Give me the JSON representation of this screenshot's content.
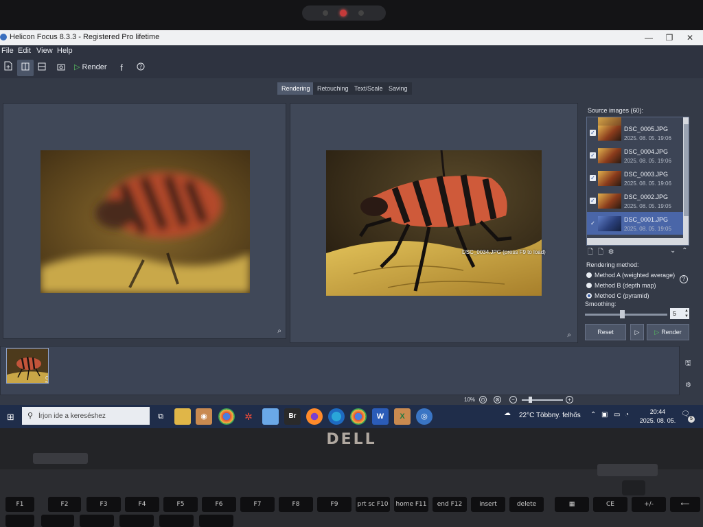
{
  "window": {
    "title": "Helicon Focus 8.3.3 - Registered Pro lifetime",
    "controls": [
      "—",
      "❐",
      "✕"
    ]
  },
  "menu": [
    "File",
    "Edit",
    "View",
    "Help"
  ],
  "toolbar": {
    "render_label": "Render"
  },
  "tabs": [
    "Rendering",
    "Retouching",
    "Text/Scale",
    "Saving"
  ],
  "preview": {
    "hint": "DSC_0034.JPG (press F9 to load)"
  },
  "sidebar": {
    "source_label": "Source images (60):",
    "images": [
      {
        "name": "DSC_0005.JPG",
        "date": "2025. 08. 05. 19:06",
        "checked": true,
        "selected": false
      },
      {
        "name": "DSC_0004.JPG",
        "date": "2025. 08. 05. 19:06",
        "checked": true,
        "selected": false
      },
      {
        "name": "DSC_0003.JPG",
        "date": "2025. 08. 05. 19:06",
        "checked": true,
        "selected": false
      },
      {
        "name": "DSC_0002.JPG",
        "date": "2025. 08. 05. 19:05",
        "checked": true,
        "selected": false
      },
      {
        "name": "DSC_0001.JPG",
        "date": "2025. 08. 05. 19:05",
        "checked": true,
        "selected": true
      }
    ],
    "rendering_method_label": "Rendering method:",
    "methods": [
      {
        "label": "Method A (weighted average)",
        "selected": false
      },
      {
        "label": "Method B (depth map)",
        "selected": false
      },
      {
        "label": "Method C (pyramid)",
        "selected": true
      }
    ],
    "smoothing_label": "Smoothing:",
    "smoothing_value": "5",
    "smoothing_fraction": 0.45,
    "reset_label": "Reset",
    "render_label": "Render"
  },
  "strip": {
    "tag": "C 5"
  },
  "zoom": {
    "percent": "10%"
  },
  "taskbar": {
    "search_placeholder": "Írjon ide a kereséshez",
    "weather": "22°C  Többny. felhős",
    "time": "20:44",
    "date": "2025. 08. 05.",
    "notification_count": "5"
  },
  "laptop": {
    "brand": "DELL"
  },
  "keyboard": {
    "fn_keys": [
      "F1",
      "F2",
      "F3",
      "F4",
      "F5",
      "F6",
      "F7",
      "F8",
      "F9",
      "prt sc F10",
      "home F11",
      "end F12",
      "insert",
      "delete"
    ],
    "extra_keys": [
      "CE",
      "+/-"
    ]
  },
  "colors": {
    "accent": "#4a66a8",
    "render_play": "#57c060",
    "taskbar": "#1f2d4a"
  }
}
